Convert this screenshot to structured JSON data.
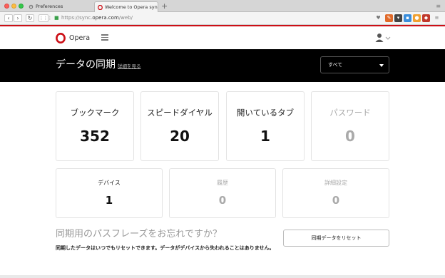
{
  "browser": {
    "tabs": [
      {
        "label": "Preferences"
      },
      {
        "label": "Welcome to Opera synchro"
      }
    ],
    "new_tab_glyph": "+",
    "url": {
      "prefix": "https://sync.",
      "domain": "opera.com",
      "path": "/web/"
    }
  },
  "header": {
    "brand": "Opera",
    "logo_icon": "opera-logo-icon",
    "accent_color": "#cc0f16"
  },
  "banner": {
    "title": "データの同期",
    "details_link": "詳細を見る",
    "filter_value": "すべて"
  },
  "cards_row1": [
    {
      "label": "ブックマーク",
      "count": "352",
      "enabled": true
    },
    {
      "label": "スピードダイヤル",
      "count": "20",
      "enabled": true
    },
    {
      "label": "開いているタブ",
      "count": "1",
      "enabled": true
    },
    {
      "label": "パスワード",
      "count": "0",
      "enabled": false
    }
  ],
  "cards_row2": [
    {
      "label": "デバイス",
      "count": "1",
      "enabled": true
    },
    {
      "label": "履歴",
      "count": "0",
      "enabled": false
    },
    {
      "label": "詳細設定",
      "count": "0",
      "enabled": false
    }
  ],
  "footer": {
    "heading": "同期用のパスフレーズをお忘れですか？",
    "text": "同期したデータはいつでもリセットできます。データがデバイスから失われることはありません。",
    "reset_button": "同期データをリセット"
  }
}
